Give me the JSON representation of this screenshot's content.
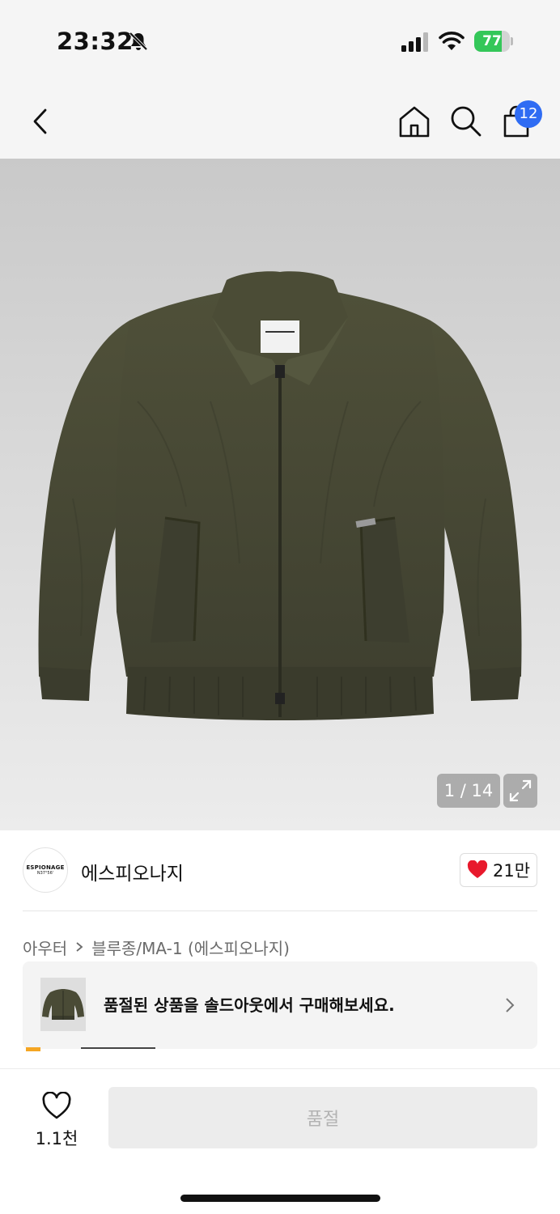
{
  "status_bar": {
    "time": "23:32",
    "battery_percent": 77,
    "battery_label": "77",
    "icons": [
      "bell-off-icon",
      "signal-icon",
      "wifi-icon",
      "battery-icon"
    ]
  },
  "nav": {
    "icons": [
      "back-icon",
      "home-icon",
      "search-icon",
      "shopping-bag-icon"
    ],
    "cart_count": "12"
  },
  "gallery": {
    "counter": "1 / 14",
    "expand_icon": "expand-icon"
  },
  "brand": {
    "logo_text": "ESPIONAGE",
    "logo_sub": "N37°56'",
    "name": "에스피오나지",
    "likes": "21만",
    "heart_color": "#e8192c"
  },
  "breadcrumb": {
    "level1": "아우터",
    "level2": "블루종/MA-1 (에스피오나지)"
  },
  "sold_banner": {
    "text": "품절된 상품을 솔드아웃에서 구매해보세요."
  },
  "bottom": {
    "wish_count": "1.1천",
    "buy_label": "품절"
  },
  "colors": {
    "accent_badge": "#2f6cf3",
    "battery": "#34c759",
    "jacket": "#4a4b36"
  }
}
